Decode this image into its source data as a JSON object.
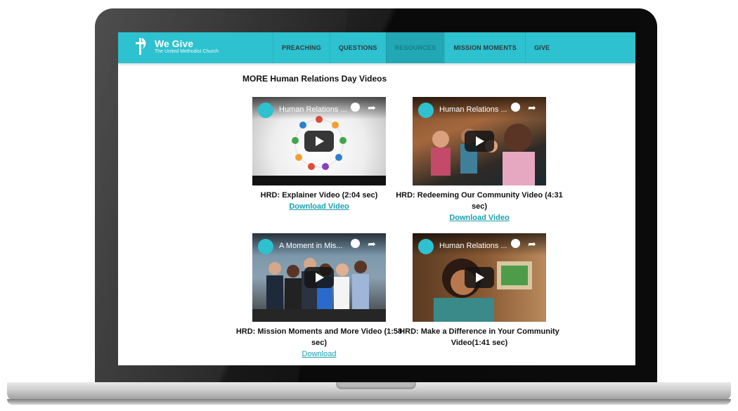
{
  "nav": {
    "brand_name": "We Give",
    "brand_subtitle": "The United Methodist Church",
    "items": [
      {
        "label": "PREACHING",
        "active": false
      },
      {
        "label": "QUESTIONS",
        "active": false
      },
      {
        "label": "RESOURCES",
        "active": true
      },
      {
        "label": "MISSION MOMENTS",
        "active": false
      },
      {
        "label": "GIVE",
        "active": false
      }
    ]
  },
  "main": {
    "heading": "MORE Human Relations Day Videos",
    "videos": [
      {
        "thumb_title": "Human Relations ...",
        "caption": "HRD: Explainer Video (2:04 sec)",
        "link": "Download Video"
      },
      {
        "thumb_title": "Human Relations ...",
        "caption": "HRD: Redeeming Our Community Video (4:31 sec)",
        "link": "Download Video"
      },
      {
        "thumb_title": "A Moment in Mis...",
        "caption": "HRD: Mission Moments and More Video (1:58 sec)",
        "link": "Download"
      },
      {
        "thumb_title": "Human Relations ...",
        "caption": "HRD: Make a Difference in Your Community Video(1:41 sec)",
        "link": ""
      }
    ],
    "channel_badge": "We Give"
  },
  "colors": {
    "nav_bg": "#2ec1cf",
    "nav_active": "#22a7b4",
    "link": "#1a9fb0"
  }
}
